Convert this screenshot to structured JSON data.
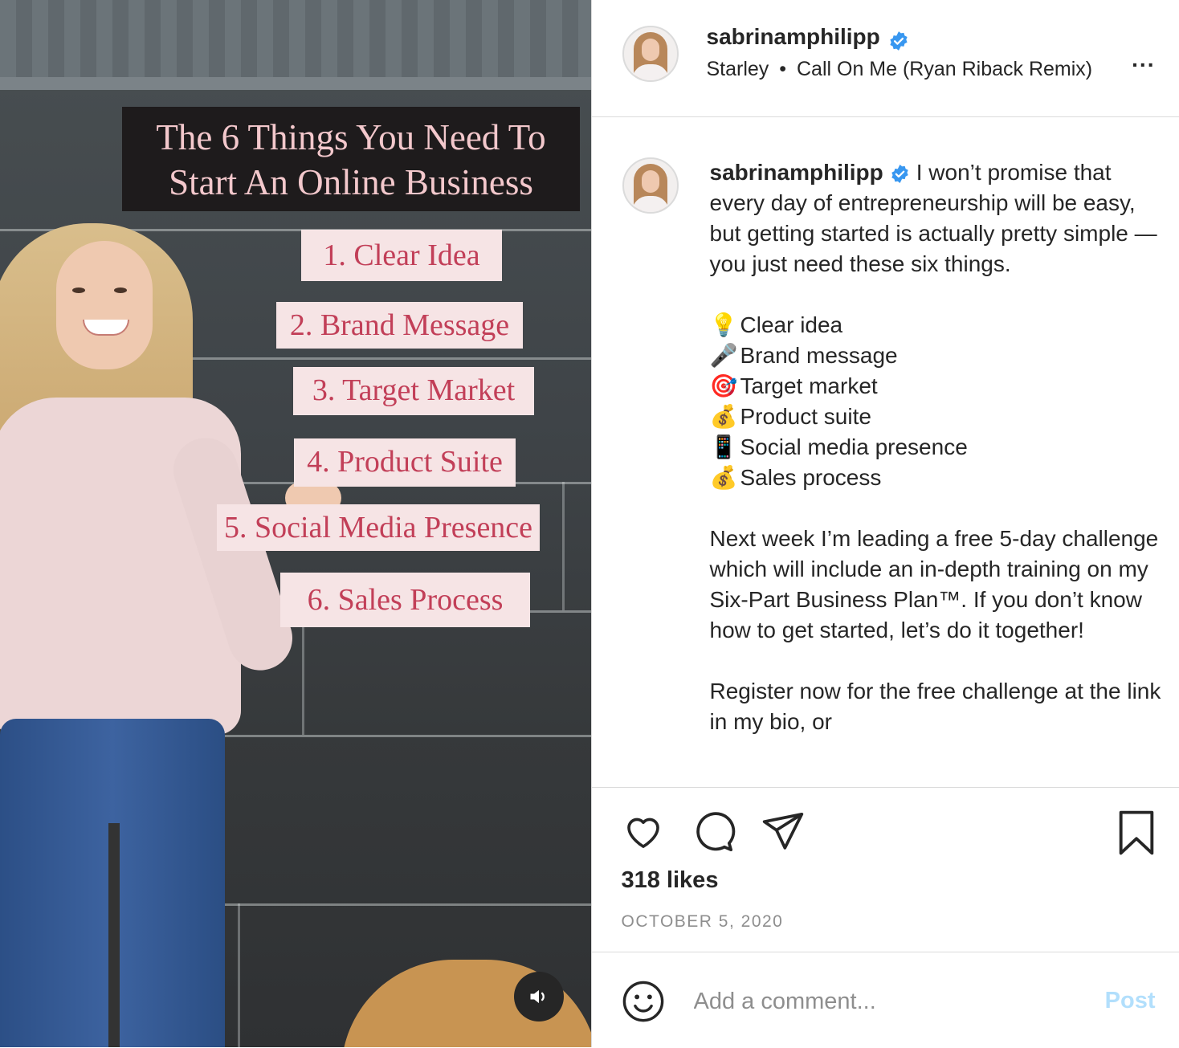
{
  "media": {
    "overlay_title_line1": "The 6 Things You Need To",
    "overlay_title_line2": "Start An Online Business",
    "overlay_items": [
      "1. Clear Idea",
      "2. Brand Message",
      "3. Target Market",
      "4. Product Suite",
      "5. Social Media Presence",
      "6. Sales Process"
    ],
    "mute_icon": "speaker-icon"
  },
  "header": {
    "username": "sabrinamphilipp",
    "verified_icon": "verified-badge-icon",
    "artist": "Starley",
    "separator": "•",
    "song": "Call On Me (Ryan Riback Remix)",
    "more_label": "..."
  },
  "caption": {
    "username": "sabrinamphilipp",
    "intro": "I won’t promise that every day of entrepreneurship will be easy, but getting started is actually pretty simple — you just need these six things.",
    "list": [
      {
        "emoji": "💡",
        "icon": "lightbulb-icon",
        "text": "Clear idea"
      },
      {
        "emoji": "🎤",
        "icon": "microphone-icon",
        "text": "Brand message"
      },
      {
        "emoji": "🎯",
        "icon": "target-icon",
        "text": "Target market"
      },
      {
        "emoji": "💰",
        "icon": "money-bag-icon",
        "text": "Product suite"
      },
      {
        "emoji": "📱",
        "icon": "phone-icon",
        "text": "Social media presence"
      },
      {
        "emoji": "💰",
        "icon": "money-bag-icon",
        "text": "Sales process"
      }
    ],
    "paragraph2": "Next week I’m leading a free 5-day challenge which will include an in-depth training on my Six-Part Business Plan™. If you don’t know how to get started, let’s do it together!",
    "paragraph3": "Register now for the free challenge at the link in my bio, or"
  },
  "stats": {
    "likes": "318 likes",
    "date": "OCTOBER 5, 2020"
  },
  "comment": {
    "placeholder": "Add a comment...",
    "post_label": "Post"
  },
  "colors": {
    "overlay_text": "#c23f58",
    "overlay_bg": "#f6e4e5",
    "verified": "#3897f0",
    "post_button_disabled": "#b2dffc"
  }
}
